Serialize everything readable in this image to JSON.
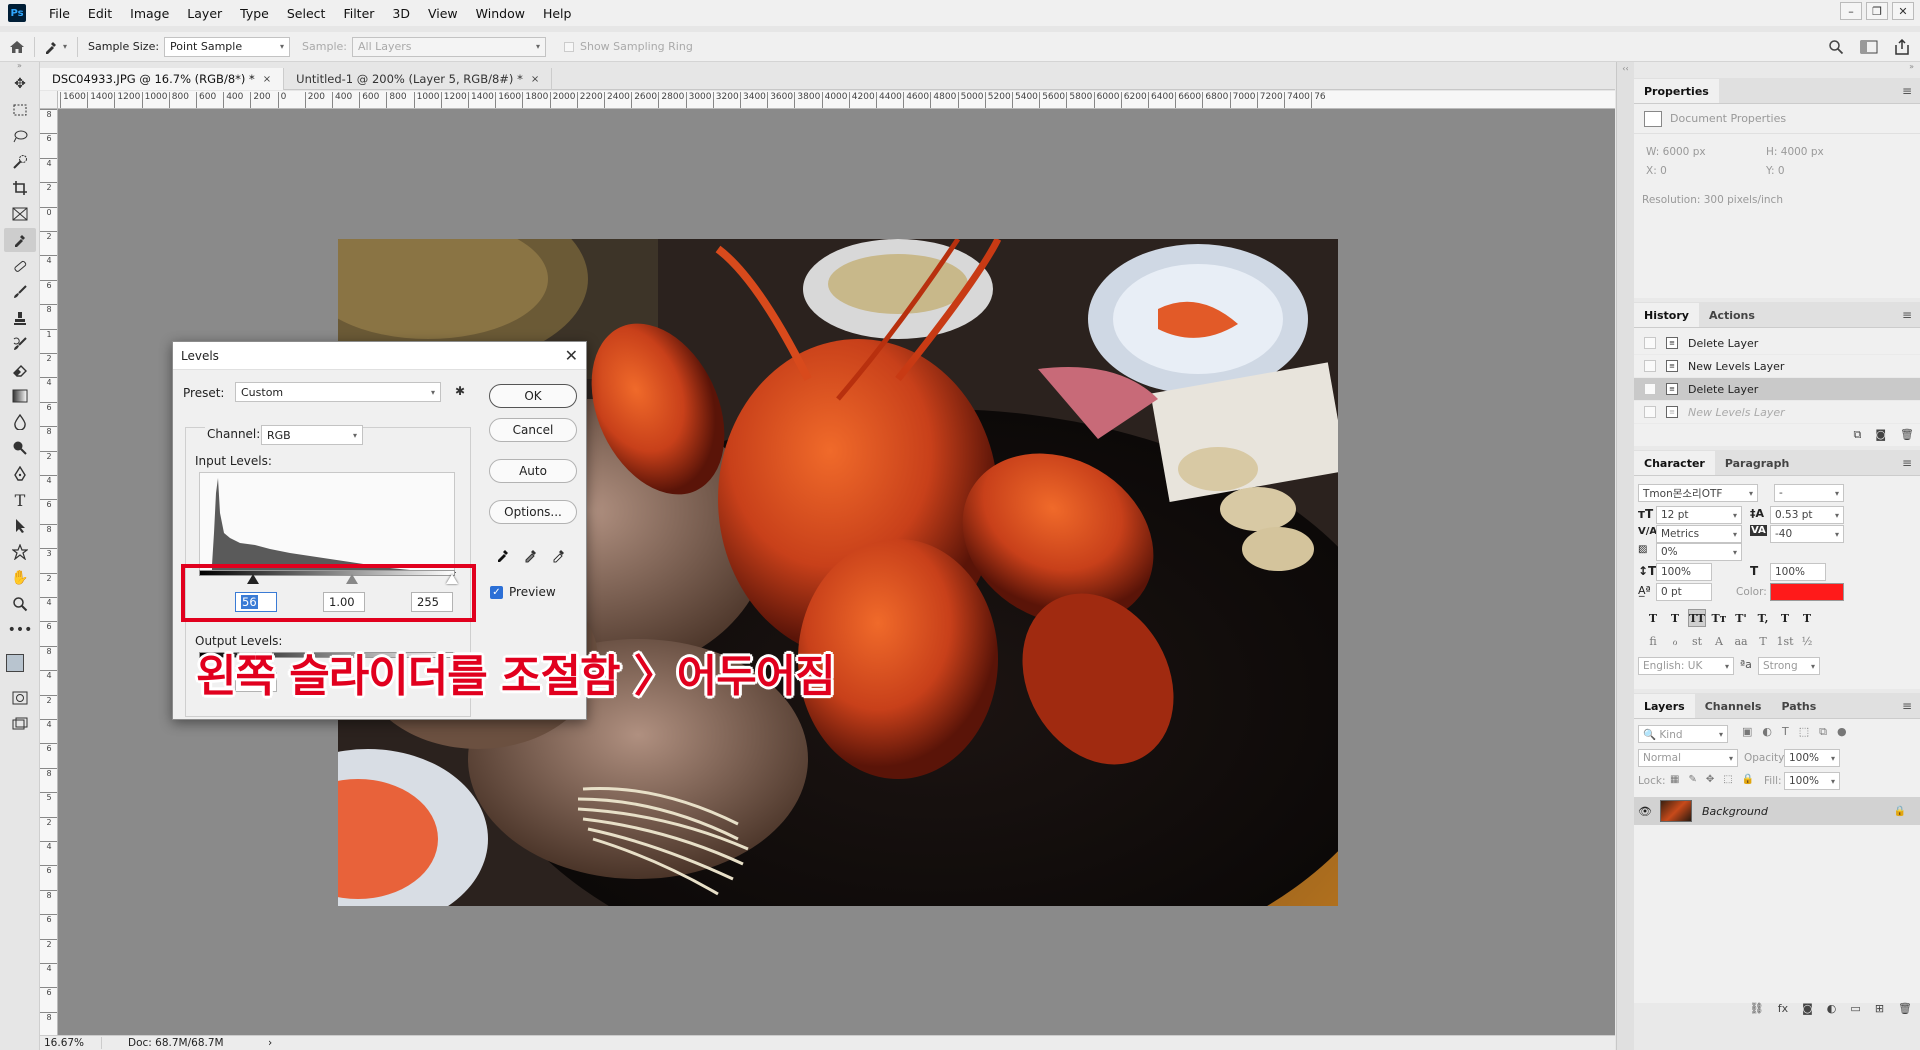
{
  "app": {
    "logo": "Ps"
  },
  "menu": [
    "File",
    "Edit",
    "Image",
    "Layer",
    "Type",
    "Select",
    "Filter",
    "3D",
    "View",
    "Window",
    "Help"
  ],
  "window_controls": {
    "minimize": "–",
    "restore": "❐",
    "close": "✕"
  },
  "options_bar": {
    "sample_size_label": "Sample Size:",
    "sample_size_value": "Point Sample",
    "sample_label": "Sample:",
    "sample_value": "All Layers",
    "show_ring_label": "Show Sampling Ring"
  },
  "tabs": [
    {
      "label": "DSC04933.JPG @ 16.7% (RGB/8*) *",
      "close": "×"
    },
    {
      "label": "Untitled-1 @ 200% (Layer 5, RGB/8#) *",
      "close": "×"
    }
  ],
  "ruler_top": [
    "1600",
    "1400",
    "1200",
    "1000",
    "800",
    "600",
    "400",
    "200",
    "0",
    "200",
    "400",
    "600",
    "800",
    "1000",
    "1200",
    "1400",
    "1600",
    "1800",
    "2000",
    "2200",
    "2400",
    "2600",
    "2800",
    "3000",
    "3200",
    "3400",
    "3600",
    "3800",
    "4000",
    "4200",
    "4400",
    "4600",
    "4800",
    "5000",
    "5200",
    "5400",
    "5600",
    "5800",
    "6000",
    "6200",
    "6400",
    "6600",
    "6800",
    "7000",
    "7200",
    "7400",
    "76"
  ],
  "ruler_left": [
    "8",
    "6",
    "4",
    "2",
    "0",
    "2",
    "4",
    "6",
    "8",
    "1",
    "2",
    "4",
    "6",
    "8",
    "2",
    "4",
    "6",
    "8",
    "3",
    "2",
    "4",
    "6",
    "8",
    "4",
    "2",
    "4",
    "6",
    "8",
    "5",
    "2",
    "4",
    "6",
    "8",
    "6",
    "2",
    "4",
    "6",
    "8"
  ],
  "status": {
    "zoom": "16.67%",
    "doc": "Doc: 68.7M/68.7M",
    "arrow": "›"
  },
  "properties": {
    "tab": "Properties",
    "doc_label": "Document Properties",
    "w": "W:  6000 px",
    "h": "H:  4000 px",
    "x": "X:  0",
    "y": "Y:  0",
    "resolution": "Resolution: 300 pixels/inch"
  },
  "history": {
    "tabs": [
      "History",
      "Actions"
    ],
    "items": [
      {
        "label": "Delete Layer",
        "state": "normal"
      },
      {
        "label": "New Levels Layer",
        "state": "normal"
      },
      {
        "label": "Delete Layer",
        "state": "selected"
      },
      {
        "label": "New Levels Layer",
        "state": "undone"
      }
    ]
  },
  "character": {
    "tabs": [
      "Character",
      "Paragraph"
    ],
    "font_family": "Tmon몬소리OTF",
    "font_style": "-",
    "size": "12 pt",
    "leading": "0.53 pt",
    "kerning": "Metrics",
    "tracking": "-40",
    "scale_sub": "0%",
    "vscale": "100%",
    "hscale": "100%",
    "baseline": "0 pt",
    "color_label": "Color:",
    "color": "#ff1a1a",
    "language": "English: UK",
    "aa_label": "ªa",
    "antialias": "Strong",
    "style_buttons": [
      "T",
      "T",
      "TT",
      "Tт",
      "T'",
      "T,",
      "T",
      "T"
    ],
    "ot_buttons": [
      "fi",
      "ℴ",
      "st",
      "A",
      "aa",
      "T",
      "1st",
      "½"
    ]
  },
  "layers": {
    "tabs": [
      "Layers",
      "Channels",
      "Paths"
    ],
    "kind": "Kind",
    "blend": "Normal",
    "opacity_label": "Opacity:",
    "opacity": "100%",
    "lock_label": "Lock:",
    "fill_label": "Fill:",
    "fill": "100%",
    "layer_name": "Background"
  },
  "levels": {
    "title": "Levels",
    "close": "✕",
    "preset_label": "Preset:",
    "preset_value": "Custom",
    "channel_label": "Channel:",
    "channel_value": "RGB",
    "input_label": "Input Levels:",
    "input_black": "56",
    "input_gamma": "1.00",
    "input_white": "255",
    "output_label": "Output Levels:",
    "output_black": "0",
    "buttons": {
      "ok": "OK",
      "cancel": "Cancel",
      "auto": "Auto",
      "options": "Options..."
    },
    "preview_label": "Preview"
  },
  "overlay": {
    "text": "왼쪽 슬라이더를 조절함 〉어두어짐",
    "color": "#e1001e"
  }
}
